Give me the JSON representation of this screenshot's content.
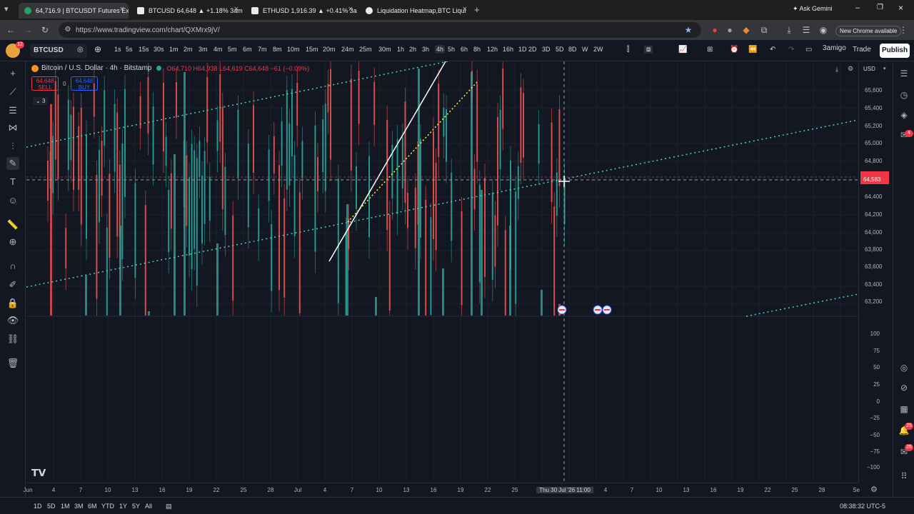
{
  "browser": {
    "tabs": [
      {
        "title": "64,716.9 | BTCUSDT Futures Exc",
        "color": "#26a269"
      },
      {
        "title": "BTCUSD 64,648 ▲ +1.18% 3am",
        "color": "#e8eaed"
      },
      {
        "title": "ETHUSD 1,916.39 ▲ +0.41% 3a",
        "color": "#e8eaed"
      },
      {
        "title": "Liquidation Heatmap,BTC Liqui",
        "color": "#e8eaed"
      }
    ],
    "ask": "Ask Gemini",
    "url": "https://www.tradingview.com/chart/QXMrx9jV/",
    "update": "New Chrome available"
  },
  "toolbar": {
    "symbol": "BTCUSD",
    "intervals": [
      "1s",
      "5s",
      "15s",
      "30s",
      "1m",
      "2m",
      "3m",
      "4m",
      "5m",
      "6m",
      "7m",
      "8m",
      "10m",
      "15m",
      "20m",
      "24m",
      "25m",
      "30m",
      "1h",
      "2h",
      "3h",
      "4h",
      "5h",
      "6h",
      "8h",
      "12h",
      "16h",
      "1D",
      "2D",
      "3D",
      "5D",
      "8D",
      "W",
      "2W"
    ],
    "selected_interval": "4h",
    "user": "3amigo",
    "trade": "Trade",
    "publish": "Publish"
  },
  "legend": {
    "title": "Bitcoin / U.S. Dollar · 4h · Bitstamp",
    "ohlc": "O64,710 H64,938 L64,619 C64,648 −61 (−0.09%)",
    "sell_price": "64,648",
    "sell_label": "SELL",
    "spread": "0",
    "buy_price": "64,648",
    "buy_label": "BUY",
    "collapsed_count": "3"
  },
  "price_axis": {
    "currency": "USD",
    "ticks": [
      "65,600",
      "65,400",
      "65,200",
      "65,000",
      "64,800",
      "64,583",
      "64,400",
      "64,200",
      "64,000",
      "63,800",
      "63,600",
      "63,400",
      "63,200"
    ],
    "current_label": "64,583"
  },
  "osc_axis": {
    "ticks": [
      "100",
      "75",
      "50",
      "25",
      "0",
      "−25",
      "−50",
      "−75",
      "−100"
    ]
  },
  "time_axis": {
    "ticks": [
      "Jun",
      "4",
      "7",
      "10",
      "13",
      "16",
      "19",
      "22",
      "25",
      "28",
      "Jul",
      "4",
      "7",
      "10",
      "13",
      "16",
      "19",
      "22",
      "25",
      "4",
      "7",
      "10",
      "13",
      "16",
      "19",
      "22",
      "25",
      "28",
      "Se"
    ],
    "crosshair_label": "Thu 30 Jul '26",
    "crosshair_time": "11:00"
  },
  "bottom": {
    "ranges": [
      "1D",
      "5D",
      "1M",
      "3M",
      "6M",
      "YTD",
      "1Y",
      "5Y",
      "All"
    ],
    "clock": "08:38:32 UTC-5"
  },
  "badges": {
    "alerts": "4",
    "notif1": "25",
    "notif2": "26",
    "profile": "12"
  },
  "colors": {
    "up": "#26a69a",
    "down": "#ef5350",
    "teal_line": "#4dd0c0",
    "yellow_line": "#f5f543",
    "accent": "#2962ff"
  }
}
